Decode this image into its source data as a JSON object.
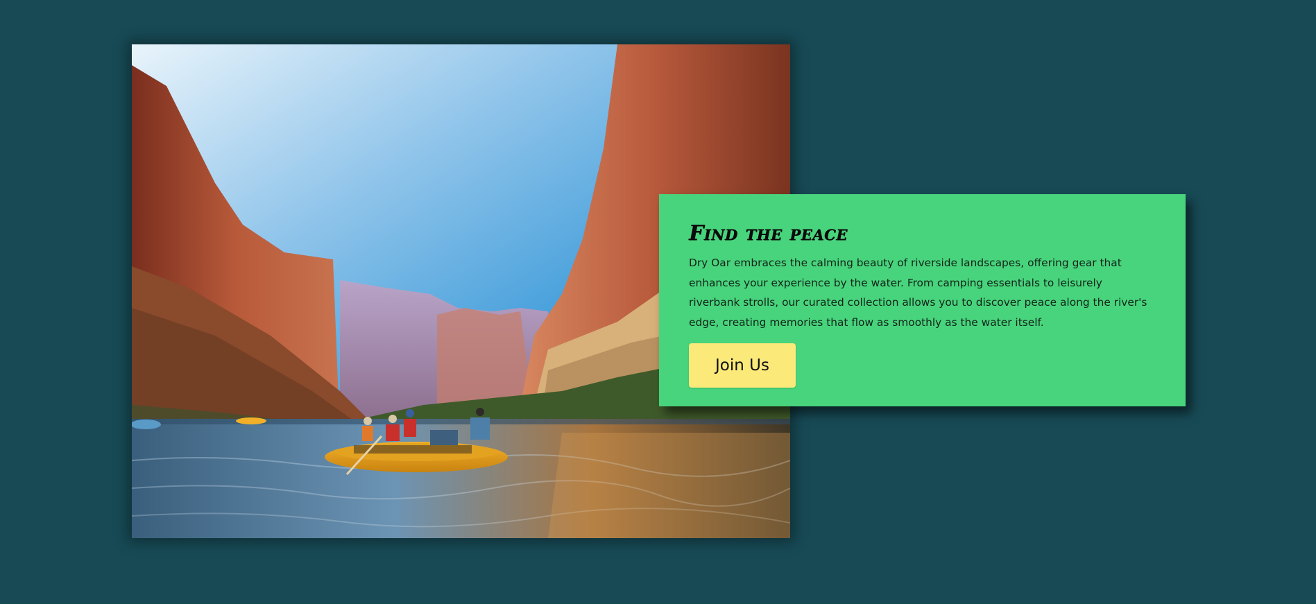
{
  "hero": {
    "image_description_icon": "canyon-river-rafting-photo"
  },
  "card": {
    "title": "Find the peace",
    "body": "Dry Oar embraces the calming beauty of riverside landscapes, offering gear that enhances your experience by the water. From camping essentials to leisurely riverbank strolls, our curated collection allows you to discover peace along the river's edge, creating memories that flow as smoothly as the water itself.",
    "button_label": "Join Us"
  },
  "colors": {
    "page_background": "#174a55",
    "card_background": "#48d47c",
    "button_background": "#fbe97a"
  }
}
